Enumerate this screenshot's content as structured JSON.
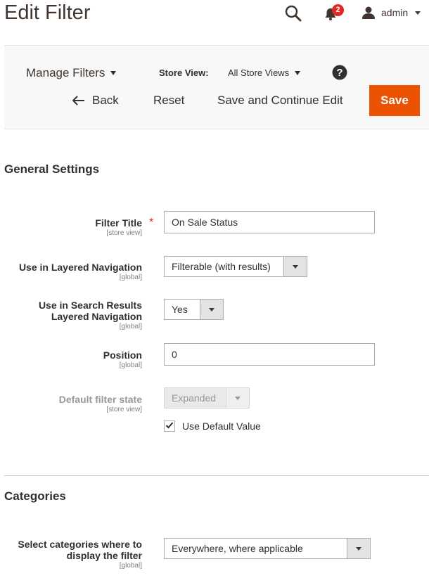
{
  "header": {
    "title": "Edit Filter",
    "notifications_count": "2",
    "user_name": "admin"
  },
  "toolbar": {
    "manage_filters": "Manage Filters",
    "store_view_label": "Store View:",
    "store_view_value": "All Store Views",
    "back_label": "Back",
    "reset_label": "Reset",
    "save_continue_label": "Save and Continue Edit",
    "save_label": "Save"
  },
  "general": {
    "section_title": "General Settings",
    "filter_title": {
      "label": "Filter Title",
      "scope": "[store view]",
      "value": "On Sale Status"
    },
    "layered_nav": {
      "label": "Use in Layered Navigation",
      "scope": "[global]",
      "value": "Filterable (with results)"
    },
    "search_nav": {
      "label_line1": "Use in Search Results",
      "label_line2": "Layered Navigation",
      "scope": "[global]",
      "value": "Yes"
    },
    "position": {
      "label": "Position",
      "scope": "[global]",
      "value": "0"
    },
    "default_state": {
      "label": "Default filter state",
      "scope": "[store view]",
      "value": "Expanded",
      "use_default_label": "Use Default Value",
      "use_default_checked": true
    }
  },
  "categories": {
    "section_title": "Categories",
    "select_categories": {
      "label_line1": "Select categories where to",
      "label_line2": "display the filter",
      "scope": "[global]",
      "value": "Everywhere, where applicable"
    }
  },
  "colors": {
    "accent": "#eb5202",
    "badge": "#e22626"
  }
}
